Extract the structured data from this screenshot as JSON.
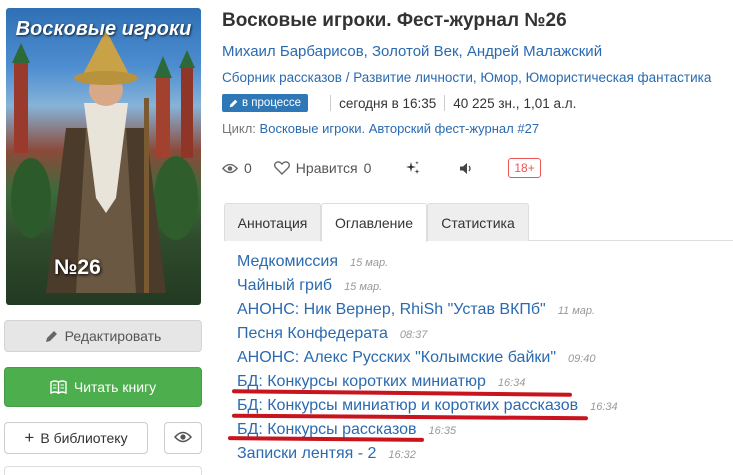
{
  "cover": {
    "title": "Восковые игроки",
    "number": "№26"
  },
  "actions": {
    "edit_label": "Редактировать",
    "read_label": "Читать книгу",
    "library_label": "В библиотеку"
  },
  "book": {
    "title": "Восковые игроки. Фест-журнал №26",
    "authors": "Михаил Барбарисов, Золотой Век, Андрей Малажский",
    "genres": "Сборник рассказов / Развитие личности, Юмор, Юмористическая фантастика",
    "status": "в процессе",
    "updated": "сегодня в 16:35",
    "size_chars": "40 225 зн.,",
    "size_al": "1,01 а.л.",
    "cycle_label": "Цикл:",
    "cycle_name": "Восковые игроки. Авторский фест-журнал #27"
  },
  "stats": {
    "views": "0",
    "likes_label": "Нравится",
    "likes": "0",
    "age_rating": "18+"
  },
  "tabs": [
    {
      "label": "Аннотация",
      "active": false
    },
    {
      "label": "Оглавление",
      "active": true
    },
    {
      "label": "Статистика",
      "active": false
    }
  ],
  "toc": [
    {
      "title": "Медкомиссия",
      "date": "15 мар."
    },
    {
      "title": "Чайный гриб",
      "date": "15 мар."
    },
    {
      "title": "АНОНС: Ник Вернер, RhiSh \"Устав ВКПб\"",
      "date": "11 мар."
    },
    {
      "title": "Песня Конфедерата",
      "date": "08:37"
    },
    {
      "title": "АНОНС: Алекс Русских \"Колымские байки\"",
      "date": "09:40"
    },
    {
      "title": "БД: Конкурсы коротких миниатюр",
      "date": "16:34"
    },
    {
      "title": "БД: Конкурсы миниатюр и коротких рассказов",
      "date": "16:34"
    },
    {
      "title": "БД: Конкурсы рассказов",
      "date": "16:35"
    },
    {
      "title": "Записки лентяя - 2",
      "date": "16:32"
    }
  ],
  "colors": {
    "link": "#2a6ab0",
    "read_button": "#4cae4c",
    "status_badge": "#2f78b7",
    "annotation_underline": "#c8141c"
  }
}
